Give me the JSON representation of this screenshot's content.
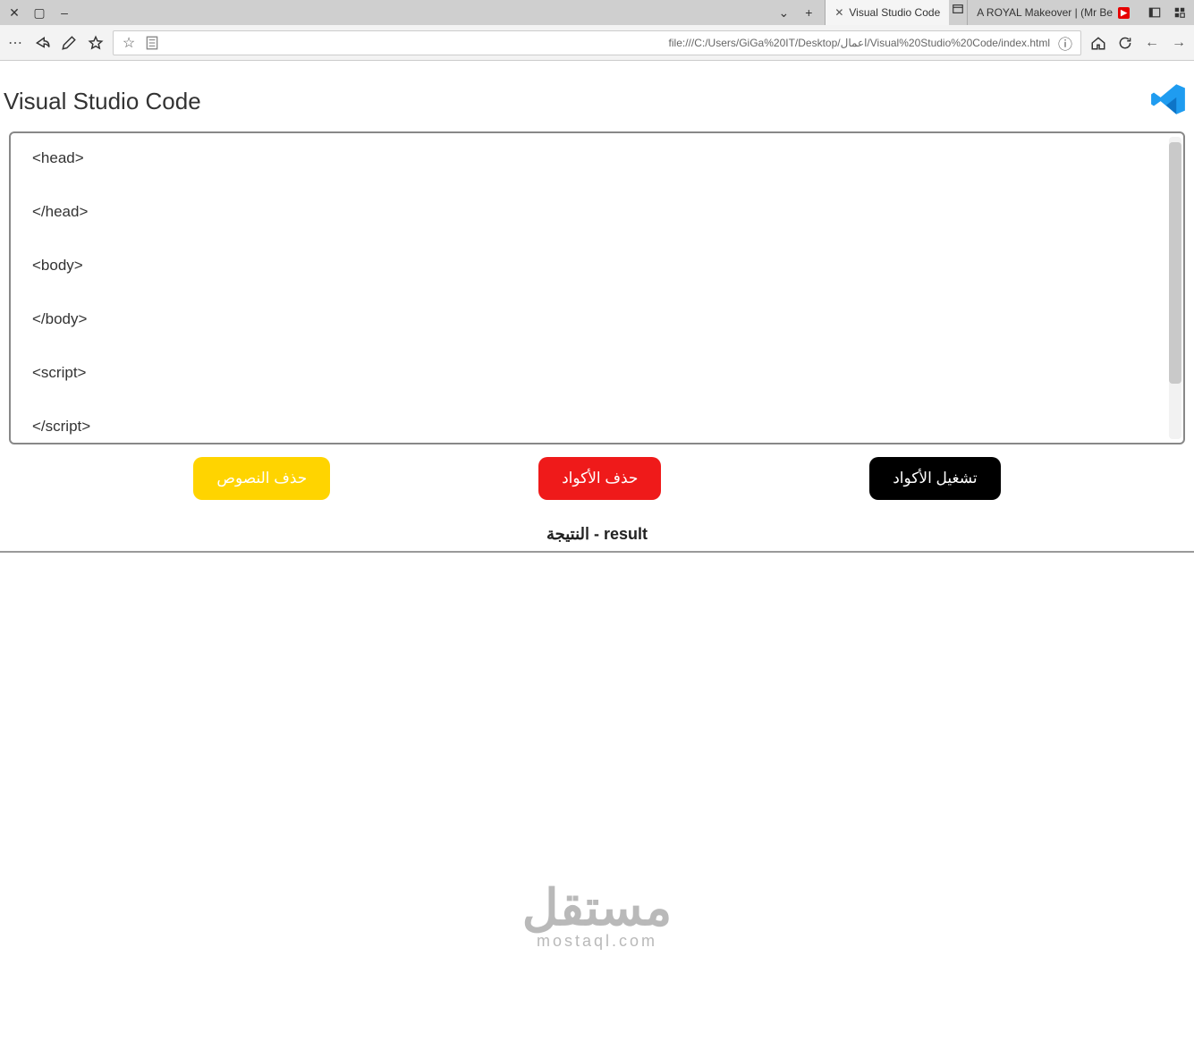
{
  "browser": {
    "window_controls": {
      "close": "✕",
      "restore": "▢",
      "minimize": "–"
    },
    "new_tab": "+",
    "dropdown": "⌄",
    "tabs": [
      {
        "title": "Visual Studio Code",
        "active": true,
        "has_close": true
      },
      {
        "title": "A ROYAL Makeover | (Mr Be",
        "active": false,
        "has_close": false,
        "badge": "▶"
      }
    ],
    "top_right_icons": [
      "sidebar-icon",
      "extensions-icon"
    ],
    "toolbar": {
      "more": "⋯",
      "url": "file:///C:/Users/GiGa%20IT/Desktop/اعمال/Visual%20Studio%20Code/index.html",
      "info": "ⓘ"
    }
  },
  "page": {
    "title": "Visual Studio Code",
    "editor_lines": [
      "<head>",
      "</head>",
      "<body>",
      "</body>",
      "<script>",
      "</script>"
    ],
    "buttons": {
      "run": "تشغيل الأكواد",
      "delete": "حذف الأكواد",
      "clear": "حذف النصوص"
    },
    "result_label": "النتيجة - result"
  },
  "watermark": {
    "arabic": "مستقل",
    "latin": "mostaql.com"
  }
}
